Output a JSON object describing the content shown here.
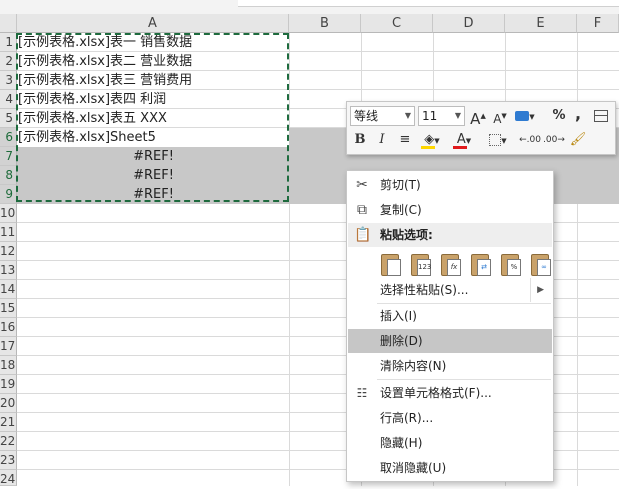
{
  "sheet": {
    "columns": [
      "A",
      "B",
      "C",
      "D",
      "E",
      "F"
    ],
    "rows": [
      "1",
      "2",
      "3",
      "4",
      "5",
      "6",
      "7",
      "8",
      "9",
      "10",
      "11",
      "12",
      "13",
      "14",
      "15",
      "16",
      "17",
      "18",
      "19",
      "20",
      "21",
      "22",
      "23",
      "24"
    ],
    "cells": [
      "[示例表格.xlsx]表一 销售数据",
      "[示例表格.xlsx]表二 营业数据",
      "[示例表格.xlsx]表三 营销费用",
      "[示例表格.xlsx]表四 利润",
      "[示例表格.xlsx]表五 XXX",
      "[示例表格.xlsx]Sheet5",
      "#REF!",
      "#REF!",
      "#REF!"
    ]
  },
  "mini_toolbar": {
    "font_name": "等线",
    "font_size": "11",
    "bold": "B",
    "italic": "I",
    "percent": "%",
    "comma": ",",
    "grow_font": "A",
    "shrink_font": "A",
    "font_color_letter": "A",
    "fill_color": "#ffd700",
    "font_color": "#e0191c",
    "inc_decimal": ".00",
    "dec_decimal": ".00"
  },
  "context_menu": {
    "cut": "剪切(T)",
    "copy": "复制(C)",
    "paste_options": "粘贴选项:",
    "paste_values_icon_text": "123",
    "paste_formula_icon_text": "fx",
    "paste_special": "选择性粘贴(S)...",
    "insert": "插入(I)",
    "delete": "删除(D)",
    "clear_contents": "清除内容(N)",
    "format_cells": "设置单元格格式(F)...",
    "row_height": "行高(R)...",
    "hide": "隐藏(H)",
    "unhide": "取消隐藏(U)"
  },
  "colors": {
    "selection_gray": "#c8c8c8",
    "marquee_green": "#1e6b3e",
    "highlight_item": "#c6c6c6"
  }
}
